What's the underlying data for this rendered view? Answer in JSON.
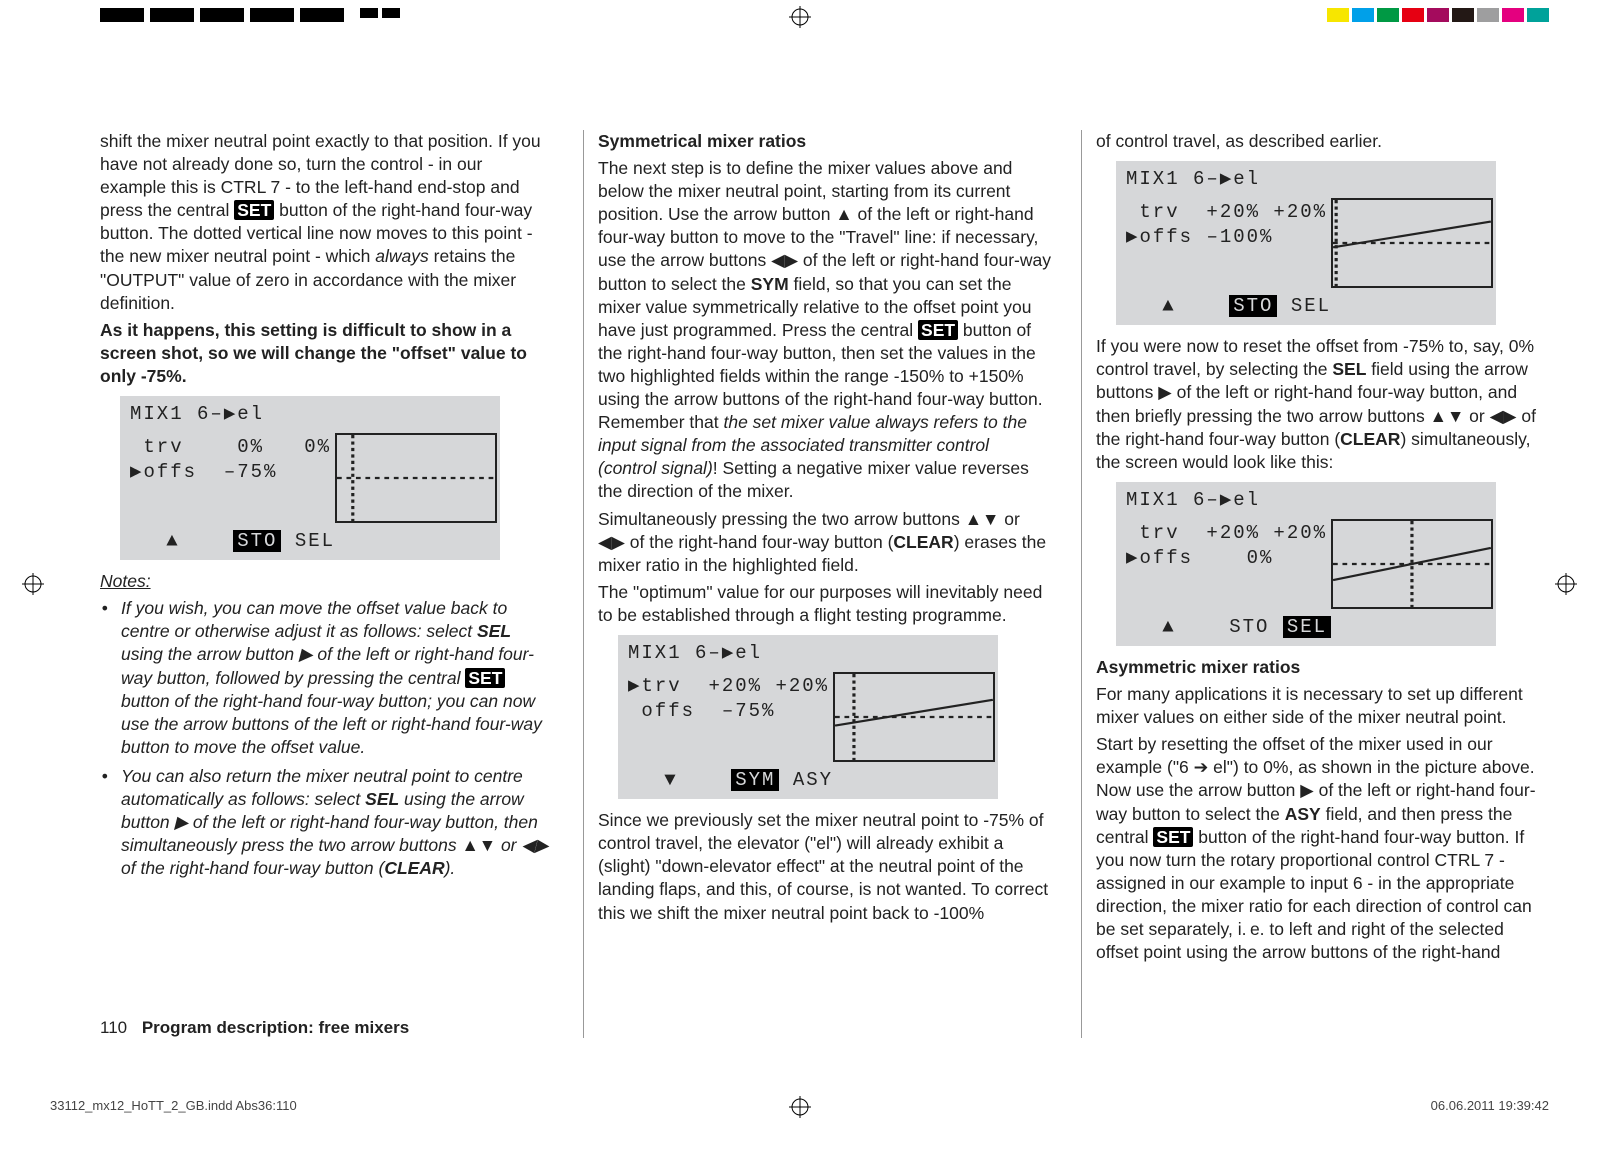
{
  "page": {
    "number": "110",
    "section": "Program description: free mixers",
    "impose_left": "33112_mx12_HoTT_2_GB.indd   Abs36:110",
    "impose_right": "06.06.2011   19:39:42"
  },
  "topmarks": {
    "colors": [
      "#f7e600",
      "#00a0e9",
      "#009944",
      "#e60012",
      "#a40b5d",
      "#231815",
      "#9e9e9f",
      "#e4007f",
      "#00a29a"
    ]
  },
  "col1": {
    "p1a": "shift the mixer neutral point exactly to that position. If you have not already done so, turn the control - in our example this is CTRL 7 - to the left-hand end-stop and press the central ",
    "set": "SET",
    "p1b": " button of the right-hand four-way button. The dotted vertical line now moves to this point - the new mixer neutral point - which ",
    "p1c_i": "always",
    "p1d": " retains the \"OUTPUT\" value of zero in accordance with the mixer definition.",
    "p2": "As it happens, this setting is difficult to show in a screen shot, so we will change the \"offset\" value to only -75%.",
    "lcd1": {
      "title": "MIX1   6–▶el",
      "row_trv": " trv    0%   0%",
      "row_offs": "▶offs  –75%",
      "footer": "   ▲    STO SEL",
      "sto": "STO"
    },
    "notes_head": "Notes:",
    "note1a": "If you wish, you can move the offset value back to centre or otherwise adjust it as follows: select ",
    "note1_sel": "SEL",
    "note1b": " using the arrow button ▶ of the left or right-hand four-way button, followed by pressing the central ",
    "note1_set": "SET",
    "note1c": " button of the right-hand four-way button; you can now use the arrow buttons of the left or right-hand four-way button to move the offset value.",
    "note2a": "You can also return the mixer neutral point to centre automatically as follows: select ",
    "note2_sel": "SEL",
    "note2b": " using the arrow button ▶ of the left or right-hand four-way button, then simultaneously press the two arrow buttons ▲▼ or ◀▶ of the right-hand four-way button (",
    "note2_clear": "CLEAR",
    "note2c": ")."
  },
  "col2": {
    "head": "Symmetrical mixer ratios",
    "p1a": "The next step is to define the mixer values above and below the mixer neutral point, starting from its current position. Use the arrow button ▲ of the left or right-hand four-way button to move to the \"Travel\" line: if necessary, use the arrow buttons ◀▶ of the left or right-hand four-way button to select the ",
    "p1_sym": "SYM",
    "p1b": " field, so that you can set the mixer value symmetrically relative to the offset point you have just programmed. Press the central ",
    "p1_set": "SET",
    "p1c": " button of the right-hand four-way button, then set the values in the two highlighted fields within the range -150% to +150% using the arrow buttons of the right-hand four-way button. Remember that ",
    "p1_i": "the set mixer value always refers to the input signal from the associated transmitter control (control signal)",
    "p1d": "! Setting a negative mixer value reverses the direction of the mixer.",
    "p2a": "Simultaneously pressing the two arrow buttons ▲▼ or ◀▶ of the right-hand four-way button (",
    "p2_clear": "CLEAR",
    "p2b": ") erases the mixer ratio in the highlighted field.",
    "p3": "The \"optimum\" value for our purposes will inevitably need to be established through a flight testing programme.",
    "lcd2": {
      "title": "MIX1   6–▶el",
      "row_trv": "▶trv  +20% +20%",
      "row_offs": " offs  –75%",
      "footer": "   ▼    SYM ASY",
      "sym": "SYM"
    },
    "p4": "Since we previously set the mixer neutral point to -75% of control travel, the elevator (\"el\") will already exhibit a (slight) \"down-elevator effect\" at the neutral point of the landing flaps, and this, of course, is not wanted. To correct this we shift the mixer neutral point back to -100%"
  },
  "col3": {
    "p0": "of control travel, as described earlier.",
    "lcd3": {
      "title": "MIX1   6–▶el",
      "row_trv": " trv  +20% +20%",
      "row_offs": "▶offs –100%",
      "footer": "   ▲    STO SEL",
      "sto": "STO"
    },
    "p1a": "If you were now to reset the offset from -75% to, say, 0% control travel, by selecting the ",
    "p1_sel": "SEL",
    "p1b": " field using the arrow buttons ▶ of the left or right-hand four-way button, and then briefly pressing the two arrow buttons ▲▼ or ◀▶ of the right-hand four-way button (",
    "p1_clear": "CLEAR",
    "p1c": ") simultaneously, the screen would look like this:",
    "lcd4": {
      "title": "MIX1   6–▶el",
      "row_trv": " trv  +20% +20%",
      "row_offs": "▶offs    0%",
      "footer": "   ▲    STO SEL",
      "sel": "SEL"
    },
    "head2": "Asymmetric mixer ratios",
    "p2": "For many applications it is necessary to set up different mixer values on either side of the mixer neutral point.",
    "p3a": "Start by resetting the offset of the mixer used in our example (\"6 ➔ el\") to 0%, as shown in the picture above. Now use the arrow button ▶ of the left or right-hand four-way button to select the ",
    "p3_asy": "ASY",
    "p3b": " field, and then press the central ",
    "p3_set": "SET",
    "p3c": " button of the right-hand four-way button. If you now turn the rotary proportional control CTRL 7 - assigned in our example to input 6 - in the appropriate direction, the mixer ratio for each direction of control can be set separately, i. e. to left and right of the selected offset point using the arrow buttons of the right-hand"
  }
}
